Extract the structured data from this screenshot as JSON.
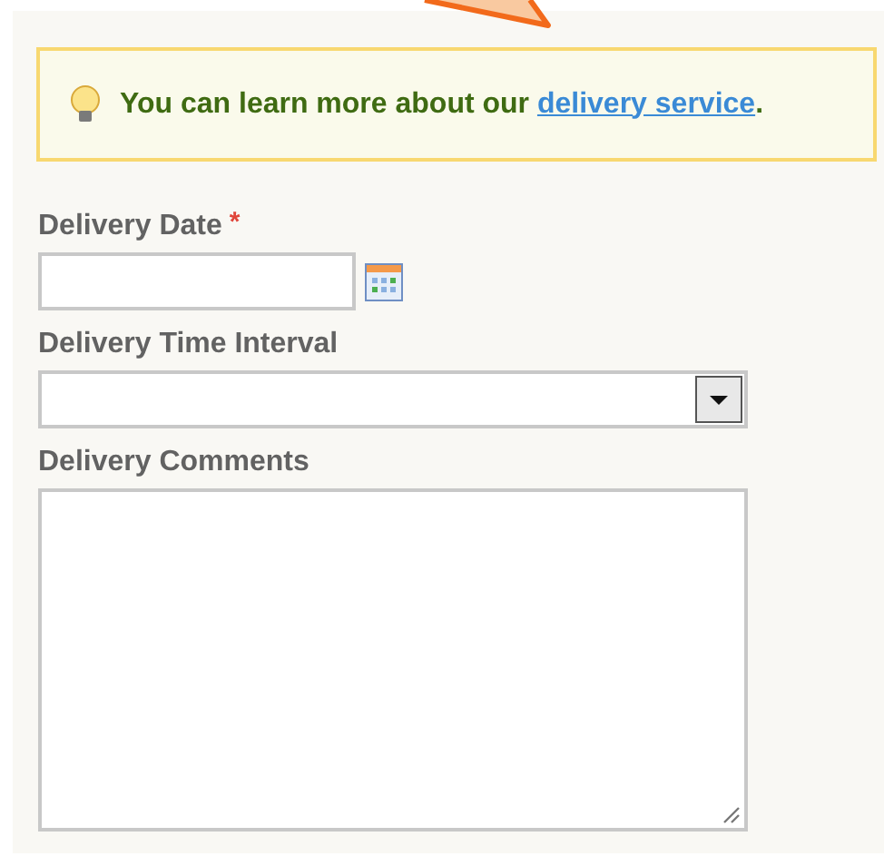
{
  "notice": {
    "text": "You can learn more about our ",
    "link": "delivery service",
    "after": "."
  },
  "fields": [
    {
      "kind": "date",
      "label": "Delivery Date",
      "required_mark": "*"
    },
    {
      "kind": "select",
      "label": "Delivery Time Interval"
    },
    {
      "kind": "textarea",
      "label": "Delivery Comments"
    }
  ]
}
